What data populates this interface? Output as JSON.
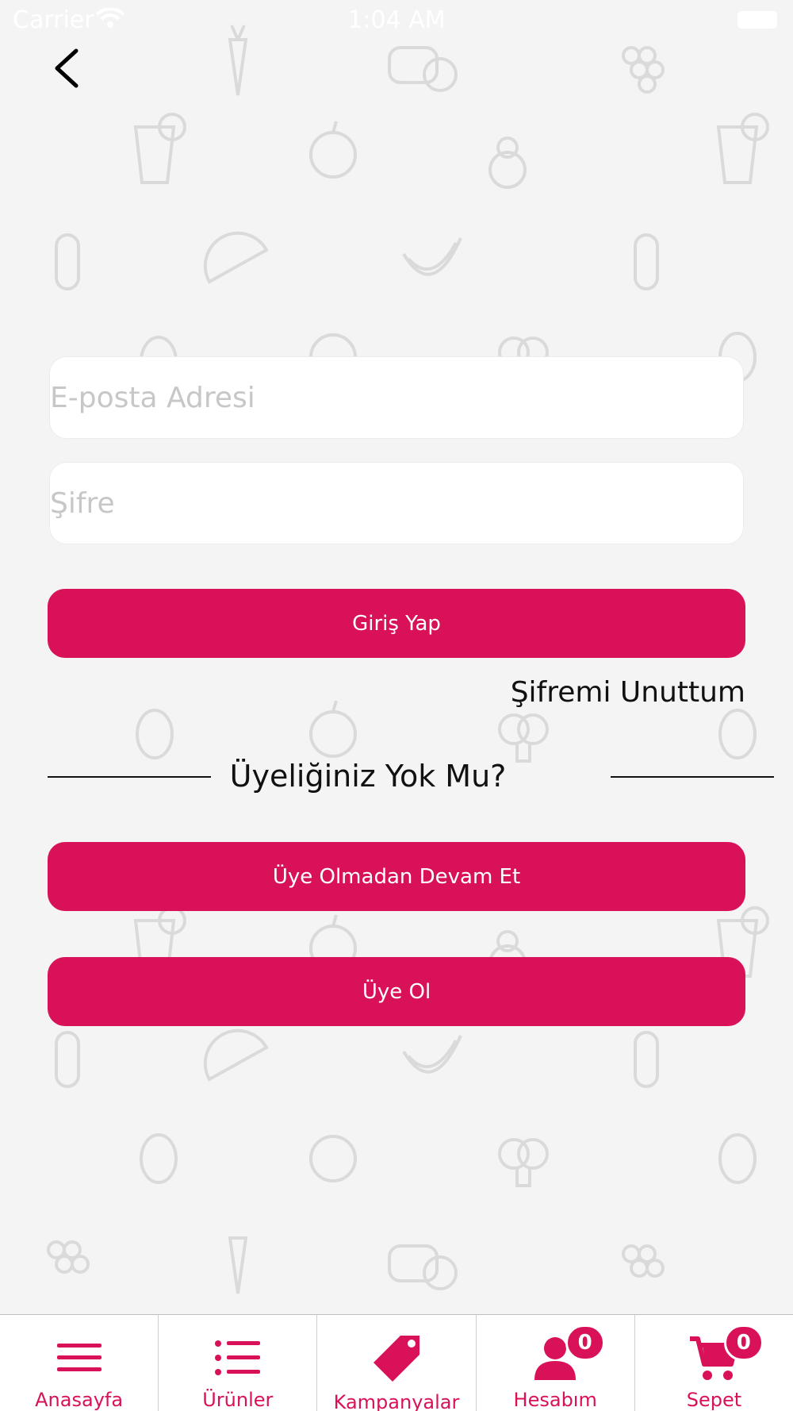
{
  "status_bar": {
    "carrier": "Carrier",
    "time": "1:04 AM"
  },
  "login": {
    "email_placeholder": "E-posta Adresi",
    "password_placeholder": "Şifre",
    "login_label": "Giriş Yap",
    "forgot_label": "Şifremi Unuttum"
  },
  "register": {
    "prompt": "Üyeliğiniz Yok Mu?",
    "guest_label": "Üye Olmadan Devam Et",
    "signup_label": "Üye Ol"
  },
  "tab_bar": {
    "items": [
      {
        "label": "Anasayfa",
        "icon": "menu-icon"
      },
      {
        "label": "Ürünler",
        "icon": "list-icon"
      },
      {
        "label": "Kampanyalar",
        "icon": "tag-icon"
      },
      {
        "label": "Hesabım",
        "icon": "user-icon",
        "badge": "0"
      },
      {
        "label": "Sepet",
        "icon": "cart-icon",
        "badge": "0"
      }
    ]
  },
  "colors": {
    "accent": "#d81159",
    "background": "#f4f4f4"
  }
}
